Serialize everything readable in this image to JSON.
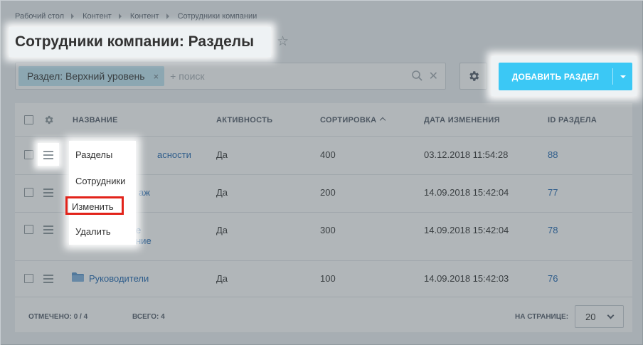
{
  "breadcrumb": [
    "Рабочий стол",
    "Контент",
    "Контент",
    "Сотрудники компании"
  ],
  "page_title": "Сотрудники компании: Разделы",
  "filter": {
    "chip_label": "Раздел: Верхний уровень",
    "chip_close": "×",
    "placeholder": "+ поиск",
    "clear": "✕"
  },
  "add_button": {
    "label": "ДОБАВИТЬ РАЗДЕЛ"
  },
  "grid": {
    "columns": [
      "НАЗВАНИЕ",
      "АКТИВНОСТЬ",
      "СОРТИРОВКА",
      "ДАТА ИЗМЕНЕНИЯ",
      "ID РАЗДЕЛА"
    ],
    "sorted_column": "СОРТИРОВКА",
    "rows": [
      {
        "name": "Служба безопасности",
        "name_visible": "асности",
        "active": "Да",
        "sort": "400",
        "date": "03.12.2018 11:54:28",
        "id": "88"
      },
      {
        "name": "Отдел продаж",
        "name_visible": "аж",
        "active": "Да",
        "sort": "200",
        "date": "14.09.2018 15:42:04",
        "id": "77"
      },
      {
        "name": "Административное управление",
        "name_visible_1": "е",
        "name_visible_2": "ние",
        "active": "Да",
        "sort": "300",
        "date": "14.09.2018 15:42:04",
        "id": "78"
      },
      {
        "name": "Руководители",
        "active": "Да",
        "sort": "100",
        "date": "14.09.2018 15:42:03",
        "id": "76"
      }
    ]
  },
  "footer": {
    "selected_label": "ОТМЕЧЕНО: 0 / 4",
    "total_label": "ВСЕГО: 4",
    "per_page_label": "НА СТРАНИЦЕ:",
    "per_page_value": "20"
  },
  "context_menu": {
    "items": [
      "Разделы",
      "Сотрудники",
      "Изменить",
      "Удалить"
    ],
    "highlighted": "Изменить"
  },
  "colors": {
    "accent": "#3bc8f5",
    "chip": "#bfe6f3",
    "link": "#2067b0",
    "highlight_border": "#e2231a"
  }
}
